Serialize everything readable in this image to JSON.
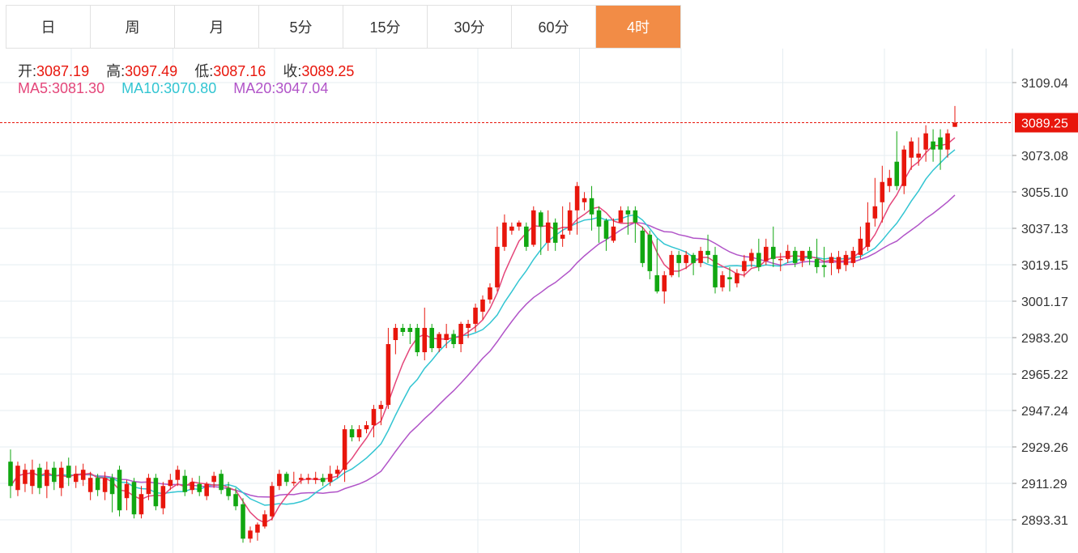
{
  "tabs": [
    {
      "label": "日",
      "active": false
    },
    {
      "label": "周",
      "active": false
    },
    {
      "label": "月",
      "active": false
    },
    {
      "label": "5分",
      "active": false
    },
    {
      "label": "15分",
      "active": false
    },
    {
      "label": "30分",
      "active": false
    },
    {
      "label": "60分",
      "active": false
    },
    {
      "label": "4时",
      "active": true
    }
  ],
  "ohlc": {
    "open_label": "开:",
    "open": "3087.19",
    "high_label": "高:",
    "high": "3097.49",
    "low_label": "低:",
    "low": "3087.16",
    "close_label": "收:",
    "close": "3089.25"
  },
  "ma": {
    "ma5_label": "MA5:",
    "ma5": "3081.30",
    "ma10_label": "MA10:",
    "ma10": "3070.80",
    "ma20_label": "MA20:",
    "ma20": "3047.04"
  },
  "colors": {
    "up": "#e8160c",
    "down": "#11a711",
    "ma5": "#e4467a",
    "ma10": "#32c5d2",
    "ma20": "#b154c8",
    "active_tab": "#f28c46",
    "price_line": "#e8160c",
    "grid": "#e5edf2"
  },
  "chart_data": {
    "type": "candlestick",
    "y_ticks": [
      "3109.04",
      "3073.08",
      "3055.10",
      "3037.13",
      "3019.15",
      "3001.17",
      "2983.20",
      "2965.22",
      "2947.24",
      "2929.26",
      "2911.29",
      "2893.31"
    ],
    "ylim": [
      2880,
      3128
    ],
    "current_price": "3089.25",
    "candles": [
      [
        2922,
        2910,
        2928,
        2904
      ],
      [
        2908,
        2920,
        2922,
        2905
      ],
      [
        2911,
        2918,
        2921,
        2907
      ],
      [
        2910,
        2918,
        2923,
        2906
      ],
      [
        2919,
        2909,
        2921,
        2906
      ],
      [
        2910,
        2918,
        2922,
        2904
      ],
      [
        2919,
        2912,
        2922,
        2908
      ],
      [
        2909,
        2919,
        2922,
        2905
      ],
      [
        2920,
        2914,
        2924,
        2910
      ],
      [
        2912,
        2916,
        2920,
        2909
      ],
      [
        2913,
        2918,
        2921,
        2910
      ],
      [
        2907,
        2914,
        2917,
        2903
      ],
      [
        2914,
        2908,
        2916,
        2905
      ],
      [
        2907,
        2914,
        2917,
        2903
      ],
      [
        2914,
        2906,
        2916,
        2897
      ],
      [
        2918,
        2898,
        2920,
        2895
      ],
      [
        2904,
        2911,
        2913,
        2898
      ],
      [
        2912,
        2896,
        2914,
        2894
      ],
      [
        2896,
        2906,
        2910,
        2894
      ],
      [
        2906,
        2914,
        2916,
        2903
      ],
      [
        2914,
        2900,
        2916,
        2898
      ],
      [
        2899,
        2910,
        2912,
        2896
      ],
      [
        2910,
        2913,
        2916,
        2908
      ],
      [
        2913,
        2918,
        2920,
        2910
      ],
      [
        2915,
        2907,
        2918,
        2905
      ],
      [
        2908,
        2912,
        2914,
        2906
      ],
      [
        2911,
        2907,
        2915,
        2905
      ],
      [
        2905,
        2911,
        2912,
        2903
      ],
      [
        2912,
        2915,
        2917,
        2909
      ],
      [
        2916,
        2908,
        2918,
        2906
      ],
      [
        2909,
        2905,
        2912,
        2903
      ],
      [
        2906,
        2900,
        2909,
        2898
      ],
      [
        2901,
        2884,
        2904,
        2882
      ],
      [
        2884,
        2888,
        2890,
        2882
      ],
      [
        2887,
        2891,
        2892,
        2883
      ],
      [
        2890,
        2896,
        2898,
        2889
      ],
      [
        2895,
        2910,
        2912,
        2893
      ],
      [
        2910,
        2916,
        2918,
        2908
      ],
      [
        2916,
        2912,
        2917,
        2910
      ],
      [
        2912,
        2912,
        2917,
        2910
      ],
      [
        2913,
        2914,
        2916,
        2911
      ],
      [
        2913,
        2914,
        2916,
        2911
      ],
      [
        2913,
        2914,
        2917,
        2911
      ],
      [
        2914,
        2912,
        2916,
        2910
      ],
      [
        2912,
        2916,
        2920,
        2910
      ],
      [
        2916,
        2918,
        2920,
        2914
      ],
      [
        2918,
        2938,
        2940,
        2912
      ],
      [
        2938,
        2934,
        2940,
        2932
      ],
      [
        2934,
        2938,
        2940,
        2932
      ],
      [
        2938,
        2940,
        2942,
        2936
      ],
      [
        2940,
        2948,
        2950,
        2934
      ],
      [
        2948,
        2950,
        2952,
        2940
      ],
      [
        2950,
        2980,
        2988,
        2948
      ],
      [
        2982,
        2988,
        2990,
        2975
      ],
      [
        2988,
        2986,
        2990,
        2984
      ],
      [
        2988,
        2986,
        2990,
        2980
      ],
      [
        2988,
        2976,
        2990,
        2974
      ],
      [
        2976,
        2988,
        2998,
        2972
      ],
      [
        2988,
        2978,
        2990,
        2976
      ],
      [
        2978,
        2985,
        2986,
        2976
      ],
      [
        2982,
        2985,
        2990,
        2978
      ],
      [
        2985,
        2980,
        2987,
        2978
      ],
      [
        2980,
        2990,
        2991,
        2976
      ],
      [
        2988,
        2990,
        2992,
        2983
      ],
      [
        2990,
        2998,
        3000,
        2986
      ],
      [
        2996,
        3002,
        3004,
        2992
      ],
      [
        3002,
        3008,
        3010,
        3000
      ],
      [
        3008,
        3028,
        3038,
        3006
      ],
      [
        3028,
        3040,
        3044,
        3026
      ],
      [
        3036,
        3038,
        3040,
        3034
      ],
      [
        3038,
        3040,
        3041,
        3036
      ],
      [
        3038,
        3028,
        3040,
        3026
      ],
      [
        3029,
        3046,
        3048,
        3028
      ],
      [
        3045,
        3038,
        3046,
        3024
      ],
      [
        3030,
        3040,
        3046,
        3026
      ],
      [
        3040,
        3030,
        3042,
        3026
      ],
      [
        3032,
        3034,
        3048,
        3028
      ],
      [
        3036,
        3046,
        3050,
        3034
      ],
      [
        3046,
        3058,
        3060,
        3034
      ],
      [
        3050,
        3052,
        3055,
        3046
      ],
      [
        3052,
        3044,
        3058,
        3036
      ],
      [
        3046,
        3038,
        3048,
        3030
      ],
      [
        3041,
        3032,
        3042,
        3026
      ],
      [
        3031,
        3038,
        3042,
        3030
      ],
      [
        3040,
        3046,
        3048,
        3040
      ],
      [
        3046,
        3044,
        3048,
        3034
      ],
      [
        3046,
        3040,
        3048,
        3030
      ],
      [
        3036,
        3020,
        3038,
        3018
      ],
      [
        3034,
        3016,
        3036,
        3012
      ],
      [
        3014,
        3006,
        3032,
        3005
      ],
      [
        3006,
        3014,
        3016,
        3000
      ],
      [
        3014,
        3024,
        3026,
        3013
      ],
      [
        3024,
        3020,
        3026,
        3013
      ],
      [
        3020,
        3024,
        3026,
        3017
      ],
      [
        3024,
        3020,
        3025,
        3014
      ],
      [
        3020,
        3026,
        3028,
        3018
      ],
      [
        3026,
        3024,
        3034,
        3020
      ],
      [
        3024,
        3008,
        3028,
        3005
      ],
      [
        3008,
        3014,
        3016,
        3006
      ],
      [
        3013,
        3012,
        3018,
        3006
      ],
      [
        3010,
        3015,
        3017,
        3008
      ],
      [
        3016,
        3021,
        3024,
        3013
      ],
      [
        3021,
        3025,
        3027,
        3018
      ],
      [
        3025,
        3018,
        3032,
        3016
      ],
      [
        3021,
        3028,
        3032,
        3019
      ],
      [
        3028,
        3022,
        3038,
        3018
      ],
      [
        3022,
        3022,
        3025,
        3016
      ],
      [
        3022,
        3026,
        3029,
        3020
      ],
      [
        3026,
        3020,
        3028,
        3018
      ],
      [
        3021,
        3026,
        3026,
        3018
      ],
      [
        3026,
        3022,
        3028,
        3019
      ],
      [
        3022,
        3018,
        3032,
        3015
      ],
      [
        3019,
        3018,
        3028,
        3013
      ],
      [
        3020,
        3023,
        3025,
        3014
      ],
      [
        3017,
        3023,
        3026,
        3015
      ],
      [
        3019,
        3024,
        3026,
        3016
      ],
      [
        3020,
        3026,
        3028,
        3018
      ],
      [
        3024,
        3032,
        3038,
        3022
      ],
      [
        3028,
        3040,
        3050,
        3026
      ],
      [
        3042,
        3048,
        3062,
        3038
      ],
      [
        3050,
        3060,
        3068,
        3040
      ],
      [
        3058,
        3062,
        3066,
        3055
      ],
      [
        3070,
        3058,
        3085,
        3056
      ],
      [
        3058,
        3076,
        3078,
        3054
      ],
      [
        3072,
        3080,
        3082,
        3066
      ],
      [
        3072,
        3074,
        3082,
        3068
      ],
      [
        3076,
        3084,
        3088,
        3070
      ],
      [
        3080,
        3076,
        3086,
        3070
      ],
      [
        3082,
        3076,
        3086,
        3066
      ],
      [
        3076,
        3084,
        3086,
        3072
      ],
      [
        3087.19,
        3089.25,
        3097.49,
        3087.16
      ]
    ]
  }
}
